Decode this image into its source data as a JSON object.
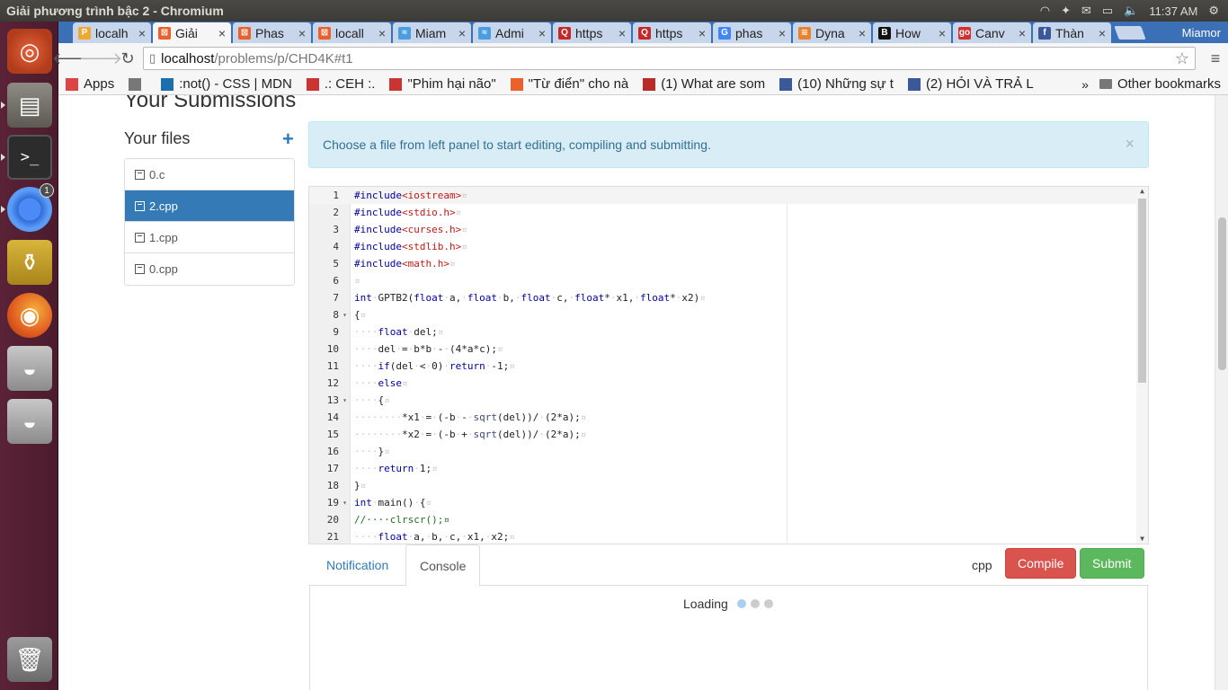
{
  "os": {
    "window_title": "Giải phương trình bậc 2 - Chromium",
    "clock": "11:37 AM",
    "chrome_badge": "1"
  },
  "browser": {
    "tabs": [
      {
        "label": "localh",
        "color": "#f0a830",
        "glyph": "P"
      },
      {
        "label": "Giải ",
        "color": "#e8612c",
        "glyph": "⊠"
      },
      {
        "label": "Phas",
        "color": "#e8612c",
        "glyph": "⊠"
      },
      {
        "label": "locall",
        "color": "#e8612c",
        "glyph": "⊠"
      },
      {
        "label": "Miam",
        "color": "#4a9de0",
        "glyph": "≈"
      },
      {
        "label": "Admi",
        "color": "#4a9de0",
        "glyph": "≈"
      },
      {
        "label": "https",
        "color": "#c62828",
        "glyph": "Q"
      },
      {
        "label": "https",
        "color": "#c62828",
        "glyph": "Q"
      },
      {
        "label": "phas",
        "color": "#4285f4",
        "glyph": "G"
      },
      {
        "label": "Dyna",
        "color": "#e8822c",
        "glyph": "≋"
      },
      {
        "label": "How",
        "color": "#111",
        "glyph": "B"
      },
      {
        "label": "Canv",
        "color": "#d32f2f",
        "glyph": "go"
      },
      {
        "label": "Thàn",
        "color": "#3b5998",
        "glyph": "f"
      }
    ],
    "profile": "Miamor",
    "url_host": "localhost",
    "url_path": "/problems/p/CHD4K#t1",
    "bookmarks": [
      {
        "label": "Apps",
        "icon": "apps-grid",
        "color": "#d44"
      },
      {
        "label": "",
        "icon": "page-icon",
        "color": "#777"
      },
      {
        "label": ":not() - CSS | MDN",
        "icon": "mdn-icon",
        "color": "#1c6fad"
      },
      {
        "label": ".: CEH :.",
        "icon": "ceh-icon",
        "color": "#c33"
      },
      {
        "label": "\"Phim hại não\"",
        "icon": "phim-icon",
        "color": "#c33"
      },
      {
        "label": "\"Từ điển\" cho nà",
        "icon": "tudien-icon",
        "color": "#e8612c"
      },
      {
        "label": "(1) What are som",
        "icon": "quora-icon",
        "color": "#b92b27"
      },
      {
        "label": "(10) Những sự t",
        "icon": "facebook-icon",
        "color": "#3b5998"
      },
      {
        "label": "(2) HỎI VÀ TRẢ L",
        "icon": "facebook-icon",
        "color": "#3b5998"
      }
    ],
    "bookmarks_more": "»",
    "other_bookmarks": "Other bookmarks"
  },
  "page": {
    "heading": "Your Submissions",
    "files_title": "Your files",
    "add_symbol": "+",
    "files": [
      "0.c",
      "2.cpp",
      "1.cpp",
      "0.cpp"
    ],
    "active_file_index": 1,
    "alert_text": "Choose a file from left panel to start editing, compiling and submitting.",
    "alert_close": "×",
    "code_lines": [
      {
        "n": "1",
        "text": "#include<iostream>¤",
        "fold": ""
      },
      {
        "n": "2",
        "text": "#include<stdio.h>¤",
        "fold": ""
      },
      {
        "n": "3",
        "text": "#include<curses.h>¤",
        "fold": ""
      },
      {
        "n": "4",
        "text": "#include<stdlib.h>¤",
        "fold": ""
      },
      {
        "n": "5",
        "text": "#include<math.h>¤",
        "fold": ""
      },
      {
        "n": "6",
        "text": "¤",
        "fold": ""
      },
      {
        "n": "7",
        "text": "int·GPTB2(float·a,·float·b,·float·c,·float*·x1,·float*·x2)¤",
        "fold": ""
      },
      {
        "n": "8",
        "text": "{¤",
        "fold": "▾"
      },
      {
        "n": "9",
        "text": "····float·del;¤",
        "fold": ""
      },
      {
        "n": "10",
        "text": "····del·=·b*b·-·(4*a*c);¤",
        "fold": ""
      },
      {
        "n": "11",
        "text": "····if(del·<·0)·return·-1;¤",
        "fold": ""
      },
      {
        "n": "12",
        "text": "····else¤",
        "fold": ""
      },
      {
        "n": "13",
        "text": "····{¤",
        "fold": "▾"
      },
      {
        "n": "14",
        "text": "········*x1·=·(-b·-·sqrt(del))/·(2*a);¤",
        "fold": ""
      },
      {
        "n": "15",
        "text": "········*x2·=·(-b·+·sqrt(del))/·(2*a);¤",
        "fold": ""
      },
      {
        "n": "16",
        "text": "····}¤",
        "fold": ""
      },
      {
        "n": "17",
        "text": "····return·1;¤",
        "fold": ""
      },
      {
        "n": "18",
        "text": "}¤",
        "fold": ""
      },
      {
        "n": "19",
        "text": "int·main()·{¤",
        "fold": "▾"
      },
      {
        "n": "20",
        "text": "//····clrscr();¤",
        "fold": ""
      },
      {
        "n": "21",
        "text": "····float·a,·b,·c,·x1,·x2;¤",
        "fold": ""
      }
    ],
    "tab_notification": "Notification",
    "tab_console": "Console",
    "language": "cpp",
    "compile_label": "Compile",
    "submit_label": "Submit",
    "loading_text": "Loading"
  }
}
